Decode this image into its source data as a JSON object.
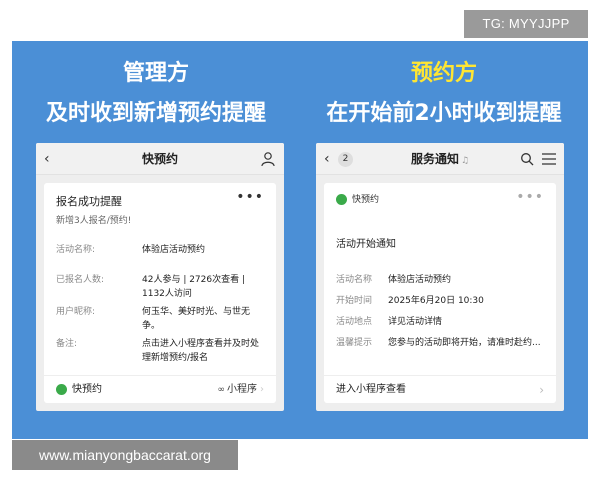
{
  "badge": "TG: MYYJJPP",
  "watermark": "www.mianyongbaccarat.org",
  "left": {
    "role": "管理方",
    "headline": "及时收到新增预约提醒",
    "nav_title": "快预约",
    "card": {
      "title": "报名成功提醒",
      "more": "•••",
      "subtitle": "新增3人报名/预约!",
      "rows": [
        {
          "k": "活动名称:",
          "v": "体验店活动预约"
        },
        {
          "k": "已报名人数:",
          "v": "42人参与 | 2726次查看 | 1132人访问"
        },
        {
          "k": "用户昵称:",
          "v": "何玉华、美好时光、与世无争。"
        },
        {
          "k": "备注:",
          "v": "点击进入小程序查看并及时处理新增预约/报名"
        }
      ],
      "footer_brand": "快预约",
      "footer_mini": "小程序"
    }
  },
  "right": {
    "role": "预约方",
    "headline": "在开始前2小时收到提醒",
    "nav_count": "2",
    "nav_title": "服务通知",
    "card": {
      "brand": "快预约",
      "more": "•••",
      "title": "活动开始通知",
      "rows": [
        {
          "k": "活动名称",
          "v": "体验店活动预约"
        },
        {
          "k": "开始时间",
          "v": "2025年6月20日 10:30"
        },
        {
          "k": "活动地点",
          "v": "详见活动详情"
        },
        {
          "k": "温馨提示",
          "v": "您参与的活动即将开始，请准时赴约..."
        }
      ],
      "footer_label": "进入小程序查看"
    }
  },
  "colors": {
    "panel_blue": "#4b8fd6",
    "right_role_yellow": "#ffe633",
    "brand_green": "#3aaa4a"
  }
}
